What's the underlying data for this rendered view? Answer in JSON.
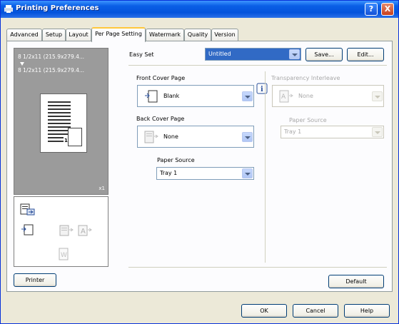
{
  "window": {
    "title": "Printing Preferences",
    "help_glyph": "?",
    "close_glyph": "X"
  },
  "tabs": [
    {
      "label": "Advanced"
    },
    {
      "label": "Setup"
    },
    {
      "label": "Layout"
    },
    {
      "label": "Per Page Setting"
    },
    {
      "label": "Watermark"
    },
    {
      "label": "Quality"
    },
    {
      "label": "Version"
    }
  ],
  "active_tab": "Per Page Setting",
  "preview": {
    "line1": "8 1/2x11 (215.9x279.4...",
    "line2": "8 1/2x11 (215.9x279.4...",
    "page_number": "1",
    "copies": "x1"
  },
  "printer_button": "Printer",
  "easy_set": {
    "label": "Easy Set",
    "value": "Untitled",
    "save_button": "Save...",
    "edit_button": "Edit..."
  },
  "front_cover": {
    "label": "Front Cover Page",
    "value": "Blank"
  },
  "back_cover": {
    "label": "Back Cover Page",
    "value": "None"
  },
  "paper_source": {
    "label": "Paper Source",
    "value": "Tray 1"
  },
  "transparency": {
    "label": "Transparency Interleave",
    "value": "None",
    "paper_source_label": "Paper Source",
    "paper_source_value": "Tray 1"
  },
  "info_glyph": "i",
  "default_button": "Default",
  "footer": {
    "ok": "OK",
    "cancel": "Cancel",
    "help": "Help"
  },
  "colors": {
    "titlebar": "#0453dc",
    "selection": "#316ac5",
    "preview_bg": "#9b9b9b"
  }
}
